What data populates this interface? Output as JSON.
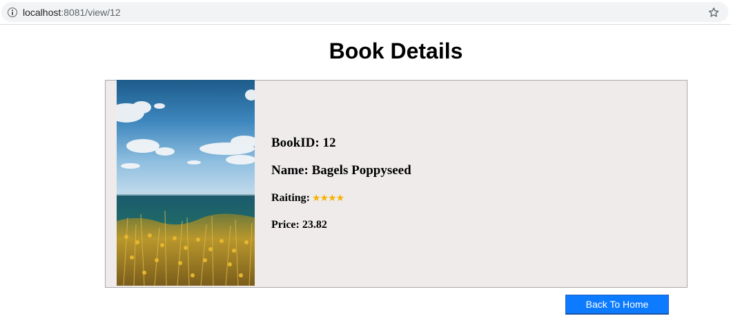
{
  "browser": {
    "url_host": "localhost",
    "url_rest": ":8081/view/12",
    "icons": [
      "info-icon",
      "star-icon"
    ]
  },
  "page": {
    "title": "Book Details"
  },
  "book": {
    "id_label": "BookID:",
    "id_value": "12",
    "name_label": "Name:",
    "name_value": "Bagels Poppyseed",
    "rating_label": "Raiting:",
    "rating_stars": 4,
    "rating_display": "★★★★",
    "price_label": "Price:",
    "price_value": "23.82"
  },
  "actions": {
    "back_label": "Back To Home"
  },
  "colors": {
    "card_bg": "#efebeb",
    "button_bg": "#0d7bff",
    "star": "#f5b301"
  }
}
